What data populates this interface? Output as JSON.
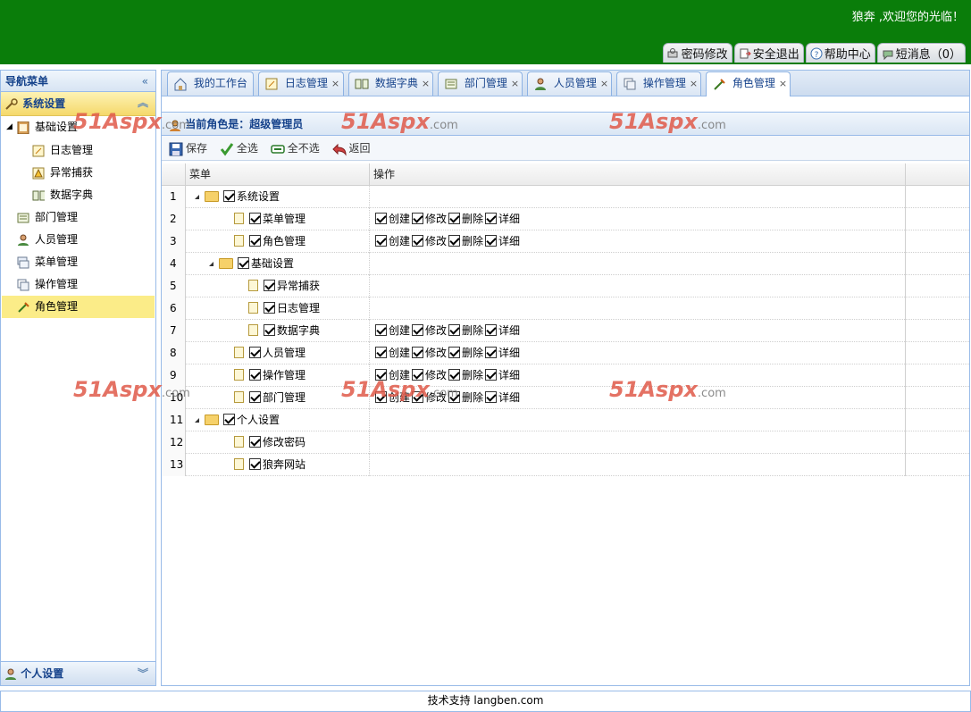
{
  "header": {
    "welcome": "狼奔 ,欢迎您的光临！",
    "toolbar": [
      {
        "icon": "key-icon",
        "label": "密码修改"
      },
      {
        "icon": "exit-icon",
        "label": "安全退出"
      },
      {
        "icon": "help-icon",
        "label": "帮助中心"
      },
      {
        "icon": "message-icon",
        "label": "短消息（0）"
      }
    ]
  },
  "sidebar": {
    "title": "导航菜单",
    "section": "系统设置",
    "items": [
      {
        "label": "基础设置",
        "icon": "book-icon",
        "level": 0,
        "expanded": true
      },
      {
        "label": "日志管理",
        "icon": "log-icon",
        "level": 1
      },
      {
        "label": "异常捕获",
        "icon": "warning-icon",
        "level": 1
      },
      {
        "label": "数据字典",
        "icon": "dictionary-icon",
        "level": 1
      },
      {
        "label": "部门管理",
        "icon": "department-icon",
        "level": 0
      },
      {
        "label": "人员管理",
        "icon": "user-icon",
        "level": 0
      },
      {
        "label": "菜单管理",
        "icon": "menu-icon",
        "level": 0
      },
      {
        "label": "操作管理",
        "icon": "operation-icon",
        "level": 0
      },
      {
        "label": "角色管理",
        "icon": "role-icon",
        "level": 0,
        "selected": true
      }
    ],
    "bottom_section": "个人设置"
  },
  "tabs": [
    {
      "label": "我的工作台",
      "icon": "home-icon",
      "closable": false
    },
    {
      "label": "日志管理",
      "icon": "log-icon",
      "closable": true
    },
    {
      "label": "数据字典",
      "icon": "dictionary-icon",
      "closable": true
    },
    {
      "label": "部门管理",
      "icon": "department-icon",
      "closable": true
    },
    {
      "label": "人员管理",
      "icon": "user-icon",
      "closable": true
    },
    {
      "label": "操作管理",
      "icon": "operation-icon",
      "closable": true
    },
    {
      "label": "角色管理",
      "icon": "role-icon",
      "closable": true,
      "active": true
    }
  ],
  "role_title": "当前角色是：超级管理员",
  "actions": [
    {
      "label": "保存",
      "icon": "save-icon"
    },
    {
      "label": "全选",
      "icon": "check-icon"
    },
    {
      "label": "全不选",
      "icon": "uncheck-icon"
    },
    {
      "label": "返回",
      "icon": "back-icon"
    }
  ],
  "grid": {
    "columns": [
      "菜单",
      "操作"
    ],
    "rows": [
      {
        "num": "1",
        "label": "系统设置",
        "type": "folder",
        "depth": 0,
        "ops": []
      },
      {
        "num": "2",
        "label": "菜单管理",
        "type": "doc",
        "depth": 1,
        "ops": [
          "创建",
          "修改",
          "删除",
          "详细"
        ]
      },
      {
        "num": "3",
        "label": "角色管理",
        "type": "doc",
        "depth": 1,
        "ops": [
          "创建",
          "修改",
          "删除",
          "详细"
        ]
      },
      {
        "num": "4",
        "label": "基础设置",
        "type": "folder",
        "depth": 1,
        "ops": []
      },
      {
        "num": "5",
        "label": "异常捕获",
        "type": "doc",
        "depth": 2,
        "ops": []
      },
      {
        "num": "6",
        "label": "日志管理",
        "type": "doc",
        "depth": 2,
        "ops": []
      },
      {
        "num": "7",
        "label": "数据字典",
        "type": "doc",
        "depth": 2,
        "ops": [
          "创建",
          "修改",
          "删除",
          "详细"
        ]
      },
      {
        "num": "8",
        "label": "人员管理",
        "type": "doc",
        "depth": 1,
        "ops": [
          "创建",
          "修改",
          "删除",
          "详细"
        ]
      },
      {
        "num": "9",
        "label": "操作管理",
        "type": "doc",
        "depth": 1,
        "ops": [
          "创建",
          "修改",
          "删除",
          "详细"
        ]
      },
      {
        "num": "10",
        "label": "部门管理",
        "type": "doc",
        "depth": 1,
        "ops": [
          "创建",
          "修改",
          "删除",
          "详细"
        ]
      },
      {
        "num": "11",
        "label": "个人设置",
        "type": "folder",
        "depth": 0,
        "ops": []
      },
      {
        "num": "12",
        "label": "修改密码",
        "type": "doc",
        "depth": 1,
        "ops": []
      },
      {
        "num": "13",
        "label": "狼奔网站",
        "type": "doc",
        "depth": 1,
        "ops": []
      }
    ]
  },
  "watermark": {
    "text": "51Aspx",
    "suffix": ".com"
  },
  "footer": "技术支持 langben.com"
}
